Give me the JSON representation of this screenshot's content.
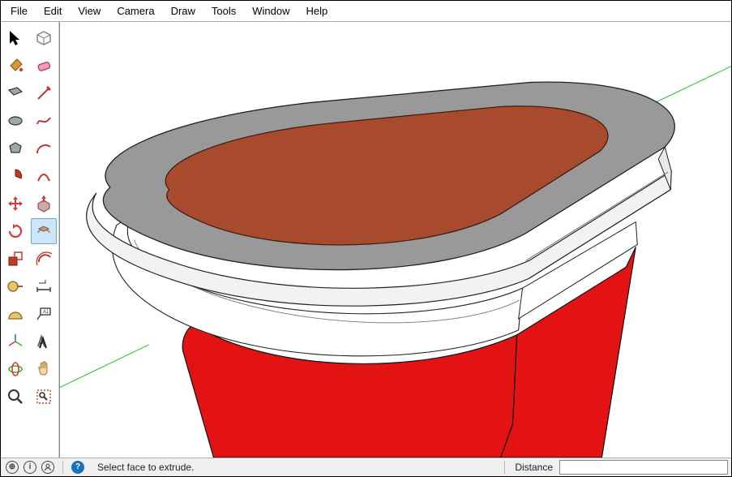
{
  "menubar": [
    "File",
    "Edit",
    "View",
    "Camera",
    "Draw",
    "Tools",
    "Window",
    "Help"
  ],
  "tools": [
    {
      "name": "select-tool",
      "active": false
    },
    {
      "name": "make-component-tool",
      "active": false
    },
    {
      "name": "paint-bucket-tool",
      "active": false
    },
    {
      "name": "eraser-tool",
      "active": false
    },
    {
      "name": "rectangle-tool",
      "active": false
    },
    {
      "name": "line-tool",
      "active": false
    },
    {
      "name": "circle-tool",
      "active": false
    },
    {
      "name": "freehand-tool",
      "active": false
    },
    {
      "name": "polygon-tool",
      "active": false
    },
    {
      "name": "arc-tool",
      "active": false
    },
    {
      "name": "pie-tool",
      "active": false
    },
    {
      "name": "two-point-arc-tool",
      "active": false
    },
    {
      "name": "move-tool",
      "active": false
    },
    {
      "name": "push-pull-tool",
      "active": false
    },
    {
      "name": "rotate-tool",
      "active": false
    },
    {
      "name": "follow-me-tool",
      "active": true
    },
    {
      "name": "scale-tool",
      "active": false
    },
    {
      "name": "offset-tool",
      "active": false
    },
    {
      "name": "tape-measure-tool",
      "active": false
    },
    {
      "name": "dimension-tool-1",
      "active": false
    },
    {
      "name": "protractor-tool",
      "active": false
    },
    {
      "name": "text-tool",
      "active": false
    },
    {
      "name": "axes-tool",
      "active": false
    },
    {
      "name": "3d-text-tool",
      "active": false
    },
    {
      "name": "orbit-tool",
      "active": false
    },
    {
      "name": "pan-tool",
      "active": false
    },
    {
      "name": "zoom-tool",
      "active": false
    },
    {
      "name": "zoom-extents-tool",
      "active": false
    }
  ],
  "status": {
    "message": "Select face to extrude.",
    "vcb_label": "Distance",
    "vcb_value": ""
  },
  "icons": {
    "geo": "⊕",
    "info": "i",
    "user": "◯",
    "help": "?"
  },
  "colors": {
    "slab_top": "#999999",
    "slab_inset": "#A84A2E",
    "body_red": "#E31313",
    "edge_white": "#ffffff",
    "axis_green": "#2dbb2d"
  }
}
